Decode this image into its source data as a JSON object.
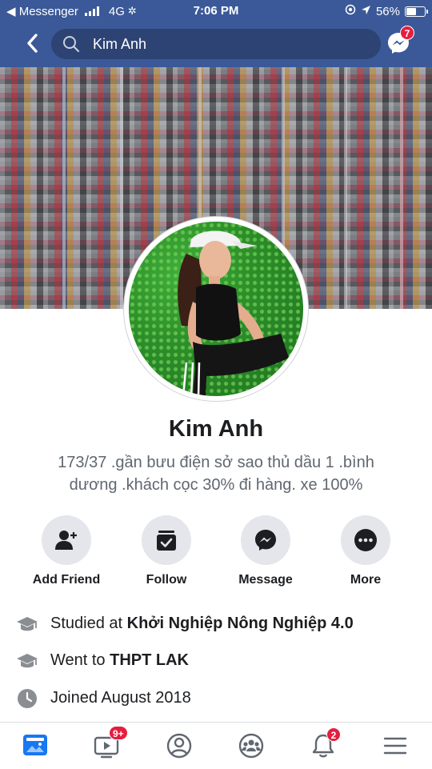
{
  "status_bar": {
    "carrier": "◀ Messenger",
    "network": "4G",
    "time": "7:06 PM",
    "battery": "56%"
  },
  "header": {
    "search_query": "Kim Anh",
    "messenger_badge": "7"
  },
  "profile": {
    "name": "Kim Anh",
    "bio_line1": "173/37 .gần  bưu điện sở sao  thủ dầu 1 .bình",
    "bio_line2": "dương .khách  cọc 30% đi  hàng. xe 100%"
  },
  "actions": [
    {
      "label": "Add Friend",
      "icon": "add-friend-icon"
    },
    {
      "label": "Follow",
      "icon": "follow-icon"
    },
    {
      "label": "Message",
      "icon": "messenger-icon"
    },
    {
      "label": "More",
      "icon": "more-icon"
    }
  ],
  "info": [
    {
      "prefix": "Studied at ",
      "value": "Khởi Nghiệp Nông Nghiệp 4.0",
      "icon": "graduation-cap-icon"
    },
    {
      "prefix": "Went to ",
      "value": "THPT LAK",
      "icon": "graduation-cap-icon"
    },
    {
      "prefix": "Joined August 2018",
      "value": "",
      "icon": "clock-icon"
    }
  ],
  "bottom_nav": {
    "watch_badge": "9+",
    "notifications_badge": "2"
  },
  "colors": {
    "header_blue": "#3b5998",
    "accent_blue": "#1877f2",
    "badge_red": "#e41e3f"
  }
}
